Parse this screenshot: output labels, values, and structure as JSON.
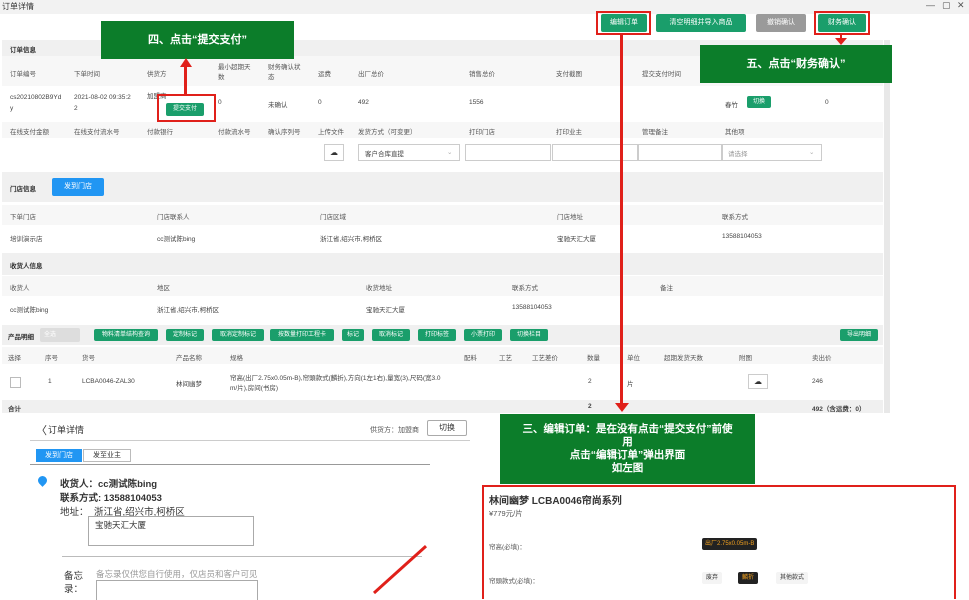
{
  "window": {
    "title": "订单详情",
    "controls": [
      "—",
      "▢",
      "✕"
    ]
  },
  "toolbar": {
    "edit": "编辑订单",
    "clear_import": "清空明细并导入商品",
    "revoke": "撤销确认",
    "finance": "财务确认"
  },
  "callouts": {
    "step4": "四、点击“提交支付”",
    "step5": "五、点击“财务确认”",
    "step3_l1": "三、编辑订单：是在没有点击“提交支付”前使",
    "step3_l2": "用",
    "step3_l3": "点击“编辑订单”弹出界面",
    "step3_l4": "如左图"
  },
  "order": {
    "section": "订单信息",
    "headers": [
      "订单编号",
      "下单时间",
      "供货方",
      "最小超期天数",
      "财务确认状态",
      "运费",
      "出厂总价",
      "销售总价",
      "支付截图",
      "提交支付时间"
    ],
    "h_min_overdue": [
      "最小超期天",
      "数"
    ],
    "h_fin": [
      "财务确认状",
      "态"
    ],
    "id": [
      "cs20210802B9Yd",
      "y"
    ],
    "time": [
      "2021-08-02 09:35:2",
      "2"
    ],
    "supplier": "加盟商",
    "submit_pay": "提交支付",
    "min_overdue": "0",
    "fin_status": "未确认",
    "freight": "0",
    "factory_total": "492",
    "sales_total": "1556",
    "owner": "春竹",
    "switch": "切换",
    "last": "0",
    "headers2": [
      "在线支付金额",
      "在线支付流水号",
      "付款银行",
      "付款流水号",
      "确认序列号",
      "上传文件",
      "发货方式（可变更）",
      "打印门店",
      "打印业主",
      "管理备注",
      "其他项"
    ],
    "ship_method": "客户合库直提",
    "other_select": "请选择"
  },
  "store": {
    "section": "门店信息",
    "send_btn": "发到门店",
    "headers": [
      "下单门店",
      "门店联系人",
      "门店区域",
      "门店地址",
      "联系方式"
    ],
    "values": [
      "培训演示店",
      "cc测试陈bing",
      "浙江省,绍兴市,柯桥区",
      "宝驰天汇大厦",
      "13588104053"
    ]
  },
  "receiver": {
    "section": "收货人信息",
    "headers": [
      "收货人",
      "地区",
      "收货地址",
      "联系方式",
      "备注"
    ],
    "values": [
      "cc测试陈bing",
      "浙江省,绍兴市,柯桥区",
      "宝驰天汇大厦",
      "13588104053",
      ""
    ]
  },
  "products": {
    "section": "产品明细",
    "toggle": "全选",
    "buttons": [
      "物料清单结构查询",
      "定制标记",
      "取消定制标记",
      "按数量打印工程卡",
      "标记",
      "取消标记",
      "打印标签",
      "小票打印",
      "切换栏目"
    ],
    "export": "导出明细",
    "headers": [
      "选择",
      "序号",
      "货号",
      "产品名称",
      "规格",
      "配料",
      "工艺",
      "工艺差价",
      "数量",
      "单位",
      "超期发货天数",
      "附图",
      "卖出价"
    ],
    "row": {
      "no": "1",
      "sku": "LCBA0046-ZAL30",
      "name": "林间幽梦",
      "spec": [
        "帘高(出厂2.75x0.05m-B),帘頭款式(麟折),方向(1左1右),量宽(3),尺码(宽3.0",
        "m/片),房间(书房)"
      ],
      "qty": "2",
      "unit": "片",
      "price": "246"
    },
    "total_label": "合计",
    "total_qty": "2",
    "total_price": "492（含运费：0）"
  },
  "mobile": {
    "back": "〈",
    "title": "订单详情",
    "supplier": "供货方：加盟商",
    "switch": "切换",
    "tab1": "发到门店",
    "tab2": "发至业主",
    "receiver": "收货人：cc测试陈bing",
    "phone": "联系方式: 13588104053",
    "addr_label": "地址：",
    "addr": "浙江省,绍兴市,柯桥区",
    "addr_detail": "宝驰天汇大厦",
    "memo_label1": "备忘",
    "memo_label2": "录：",
    "memo_hint": "备忘录仅供您自行使用，仅店员和客户可见"
  },
  "product_panel": {
    "title": "林间幽梦 LCBA0046帘尚系列",
    "price": "¥779元/片",
    "height_label": "帘高(必填)：",
    "height_value": "出厂2.75x0.05m-B",
    "style_label": "帘頭款式(必填)：",
    "style_options": [
      "废弃",
      "麟折",
      "其他款式"
    ]
  }
}
